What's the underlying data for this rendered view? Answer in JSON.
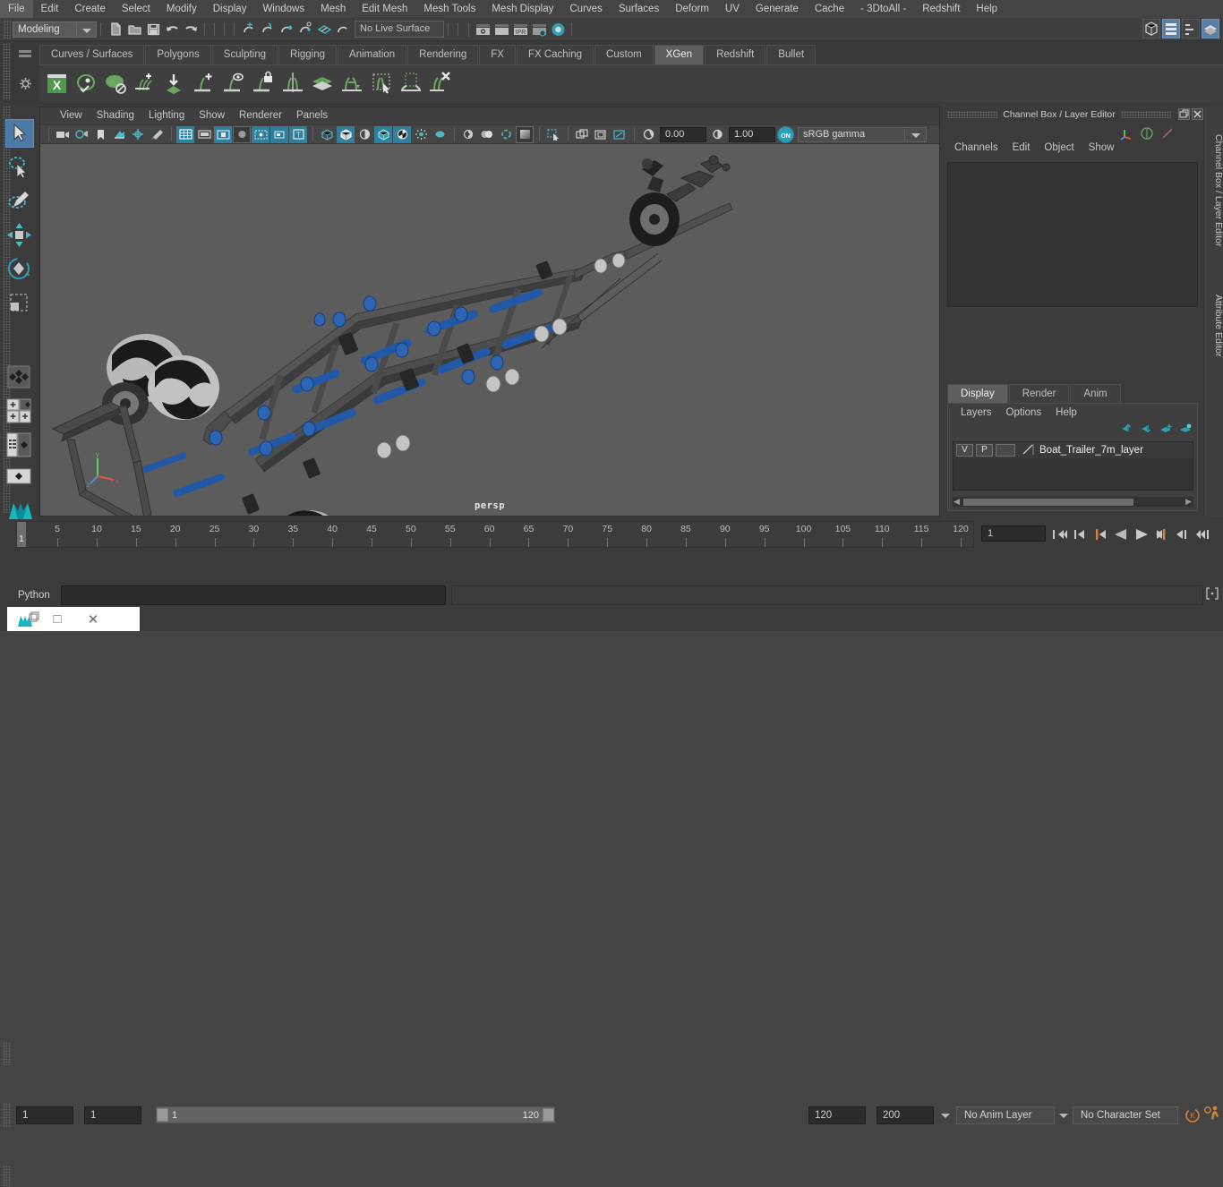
{
  "app": {
    "title": "Autodesk Maya",
    "menu_items": [
      "File",
      "Edit",
      "Create",
      "Select",
      "Modify",
      "Display",
      "Windows",
      "Mesh",
      "Edit Mesh",
      "Mesh Tools",
      "Mesh Display",
      "Curves",
      "Surfaces",
      "Deform",
      "UV",
      "Generate",
      "Cache",
      "- 3DtoAll -",
      "Redshift",
      "Help"
    ]
  },
  "status_line": {
    "menu_set": "Modeling",
    "live_surface": "No Live Surface",
    "icons": [
      "new-scene-icon",
      "open-scene-icon",
      "save-scene-icon",
      "undo-icon",
      "redo-icon",
      "select-by-hierarchy-icon",
      "select-by-object-icon",
      "select-by-component-icon",
      "snap-to-grid-icon",
      "snap-to-curve-icon",
      "snap-to-point-icon",
      "snap-to-projected-center-icon",
      "snap-to-view-plane-icon",
      "make-live-icon",
      "render-current-frame-icon",
      "ipr-render-icon",
      "render-settings-icon",
      "hypershade-icon"
    ],
    "right_buttons": [
      "toggle-model-panel-icon",
      "toggle-attribute-editor-icon",
      "toggle-tool-settings-icon",
      "toggle-channel-box-icon"
    ]
  },
  "shelf": {
    "tabs": [
      "Curves / Surfaces",
      "Polygons",
      "Sculpting",
      "Rigging",
      "Animation",
      "Rendering",
      "FX",
      "FX Caching",
      "Custom",
      "XGen",
      "Redshift",
      "Bullet"
    ],
    "active_tab": "XGen",
    "buttons": [
      "xgen-editor-icon",
      "xgen-preview-icon",
      "xgen-disable-preview-icon",
      "xgen-add-groom-icon",
      "xgen-import-icon",
      "xgen-add-guide-icon",
      "xgen-guide-visibility-icon",
      "xgen-lock-guide-icon",
      "xgen-mirror-guide-icon",
      "xgen-layers-icon",
      "xgen-transfer-icon",
      "xgen-select-guide-icon",
      "xgen-mask-icon",
      "xgen-delete-icon"
    ]
  },
  "toolbox": {
    "tools": [
      "select-tool",
      "lasso-select-tool",
      "paint-select-tool",
      "move-tool",
      "rotate-tool",
      "scale-tool"
    ],
    "active_tool": "select-tool",
    "layouts": [
      "single-perspective-layout",
      "four-view-layout",
      "outliner-persp-layout",
      "persp-only-layout"
    ]
  },
  "viewport": {
    "menus": [
      "View",
      "Shading",
      "Lighting",
      "Show",
      "Renderer",
      "Panels"
    ],
    "camera_label": "persp",
    "exposure": "0.00",
    "gamma": "1.00",
    "color_management": "sRGB gamma",
    "cm_toggle": "ON",
    "toolbar_icons": [
      "select-camera-icon",
      "camera-attributes-icon",
      "bookmark-icon",
      "image-plane-icon",
      "two-d-pan-zoom-icon",
      "grease-pencil-icon",
      "grid-toggle-icon",
      "film-gate-icon",
      "resolution-gate-icon",
      "gate-mask-icon",
      "xray-joints-icon",
      "xray-icon",
      "texture-border-icon",
      "wireframe-icon",
      "smooth-shade-icon",
      "shaded-wireframe-icon",
      "textured-icon",
      "use-all-lights-icon",
      "shadows-icon",
      "ao-icon",
      "motion-blur-icon",
      "multisample-icon",
      "depth-peeling-icon",
      "isolate-select-icon",
      "display-layer-icon",
      "grid-display-icon",
      "viewport-snapshot-icon"
    ],
    "model": "Boat trailer 3D model"
  },
  "right_panel": {
    "title": "Channel Box / Layer Editor",
    "window_buttons": [
      "undock-icon",
      "close-icon"
    ],
    "channel_menus": [
      "Channels",
      "Edit",
      "Object",
      "Show"
    ],
    "mini_icons": [
      "manipulator-icon",
      "no-manipulator-icon",
      "speed-icon"
    ],
    "vertical_tabs": [
      "Channel Box / Layer Editor",
      "Attribute Editor"
    ],
    "layer_tabs": [
      "Display",
      "Render",
      "Anim"
    ],
    "active_layer_tab": "Display",
    "layer_menus": [
      "Layers",
      "Options",
      "Help"
    ],
    "layer_toolbar_icons": [
      "move-layer-up-icon",
      "move-layer-down-icon",
      "new-layer-icon",
      "new-layer-from-selected-icon"
    ],
    "layers": [
      {
        "visibility": "V",
        "playback": "P",
        "shading": "",
        "name": "Boat_Trailer_7m_layer"
      }
    ]
  },
  "timeline": {
    "start": 1,
    "end": 120,
    "tick_step": 5,
    "labels": [
      5,
      10,
      15,
      20,
      25,
      30,
      35,
      40,
      45,
      50,
      55,
      60,
      65,
      70,
      75,
      80,
      85,
      90,
      95,
      100,
      105,
      110,
      115,
      120
    ],
    "current_frame": "1",
    "playback_field": "1",
    "transport_buttons": [
      "go-to-start-icon",
      "step-back-keyframe-icon",
      "step-back-frame-icon",
      "play-backwards-icon",
      "play-forwards-icon",
      "step-forward-frame-icon",
      "step-forward-keyframe-icon",
      "go-to-end-icon"
    ]
  },
  "range_slider": {
    "anim_start": "1",
    "range_start": "1",
    "range_bar_start": "1",
    "range_bar_end": "120",
    "range_end": "120",
    "anim_end": "200",
    "anim_layer": "No Anim Layer",
    "character_set": "No Character Set",
    "right_icons": [
      "auto-keyframe-icon",
      "animation-preferences-icon"
    ]
  },
  "command_line": {
    "language": "Python",
    "input_value": "",
    "result_value": ""
  },
  "taskbar_overlay": {
    "icons": [
      "maya-app-icon",
      "restore-window-icon"
    ],
    "buttons": [
      "maximize-icon",
      "close-icon"
    ],
    "maximize_glyph": "□",
    "close_glyph": "✕"
  },
  "colors": {
    "accent_teal": "#2f9fb5",
    "accent_blue": "#4a7aa5",
    "shelf_green": "#6aa860",
    "orange": "#d1823c",
    "viewport_bg": "#5c5c5c",
    "model_blue": "#2a5fa8"
  }
}
